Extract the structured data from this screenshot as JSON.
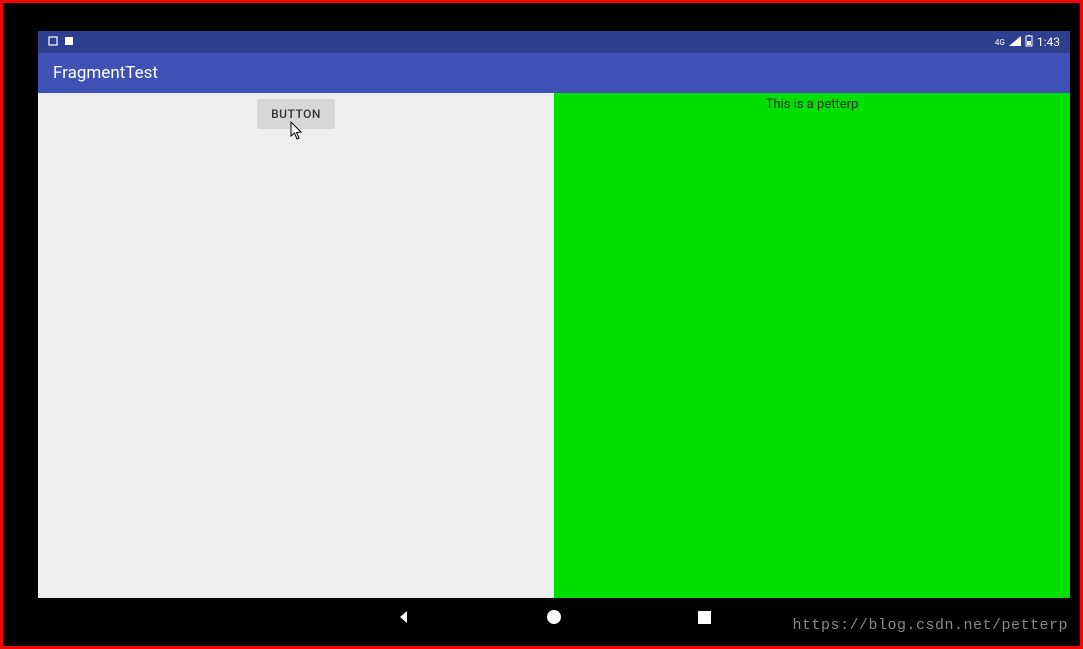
{
  "statusBar": {
    "network": "4G",
    "signalIcon": "signal-icon",
    "batteryIcon": "battery-icon",
    "time": "1:43"
  },
  "actionBar": {
    "title": "FragmentTest"
  },
  "leftFragment": {
    "buttonLabel": "BUTTON"
  },
  "rightFragment": {
    "text": "This is a petterp",
    "backgroundColor": "#00e000"
  },
  "navBar": {
    "back": "back",
    "home": "home",
    "recent": "recent"
  },
  "watermark": "https://blog.csdn.net/petterp"
}
